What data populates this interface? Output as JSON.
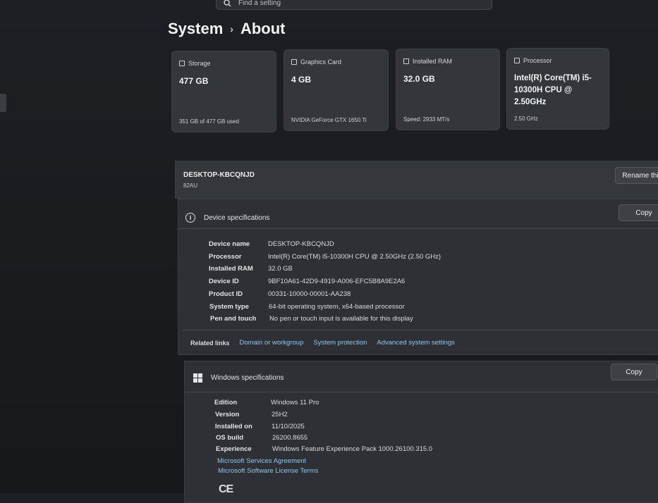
{
  "search": {
    "placeholder": "Find a setting"
  },
  "breadcrumb": {
    "parent": "System",
    "separator": "›",
    "current": "About"
  },
  "cards": [
    {
      "title": "Storage",
      "value": "477 GB",
      "footer": "351 GB of 477 GB used"
    },
    {
      "title": "Graphics Card",
      "value": "4 GB",
      "footer": "NVIDIA GeForce GTX 1650 Ti"
    },
    {
      "title": "Installed RAM",
      "value": "32.0 GB",
      "footer": "Speed: 2933 MT/s"
    },
    {
      "title": "Processor",
      "value": "Intel(R) Core(TM) i5-10300H CPU @ 2.50GHz",
      "footer": "2.50 GHz"
    }
  ],
  "pc": {
    "name": "DESKTOP-KBCQNJD",
    "model": "82AU",
    "rename_label": "Rename thi"
  },
  "device_specs": {
    "title": "Device specifications",
    "copy_label": "Copy",
    "rows": [
      {
        "key": "Device name",
        "value": "DESKTOP-KBCQNJD"
      },
      {
        "key": "Processor",
        "value": "Intel(R) Core(TM) i5-10300H CPU @ 2.50GHz (2.50 GHz)"
      },
      {
        "key": "Installed RAM",
        "value": "32.0 GB"
      },
      {
        "key": "Device ID",
        "value": "9BF10A61-42D9-4919-A006-EFC5B8A9E2A6"
      },
      {
        "key": "Product ID",
        "value": "00331-10000-00001-AA238"
      },
      {
        "key": "System type",
        "value": "64-bit operating system, x64-based processor"
      },
      {
        "key": "Pen and touch",
        "value": "No pen or touch input is available for this display"
      }
    ]
  },
  "related": {
    "label": "Related links",
    "links": [
      "Domain or workgroup",
      "System protection",
      "Advanced system settings"
    ]
  },
  "windows_specs": {
    "title": "Windows specifications",
    "copy_label": "Copy",
    "rows": [
      {
        "key": "Edition",
        "value": "Windows 11 Pro"
      },
      {
        "key": "Version",
        "value": "25H2"
      },
      {
        "key": "Installed on",
        "value": "11/10/2025"
      },
      {
        "key": "OS build",
        "value": "26200.8655"
      },
      {
        "key": "Experience",
        "value": "Windows Feature Experience Pack 1000.26100.315.0"
      }
    ],
    "links": [
      "Microsoft Services Agreement",
      "Microsoft Software License Terms"
    ]
  },
  "footer_logo": "CE"
}
